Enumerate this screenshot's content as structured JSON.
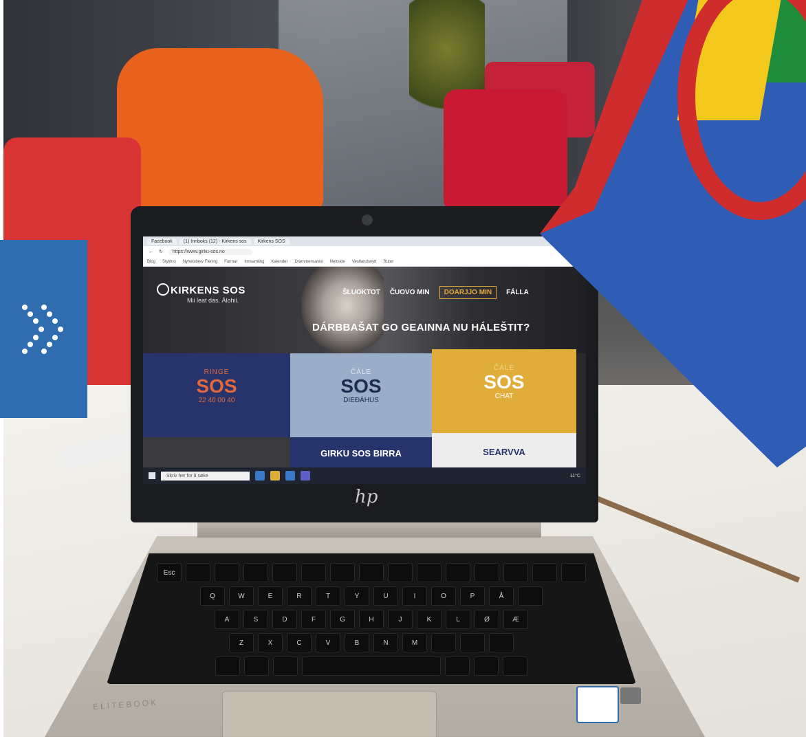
{
  "browser": {
    "tabs": [
      "Facebook",
      "(1) Innboks (12) - Kirkens sos",
      "Kirkens SOS"
    ],
    "url": "https://www.girku-sos.no",
    "bookmarks": [
      "Blog",
      "Stylitno",
      "Nyhetsbrev Flering",
      "Farmar",
      "Innsamling",
      "Kalender",
      "Drammensavisl",
      "Nettside",
      "Vestlandsnytt",
      "Ruter"
    ]
  },
  "site": {
    "logo": "KIRKENS SOS",
    "tagline": "Mii leat dás. Álohii.",
    "nav": [
      "ŠLUOKTOT",
      "ČUOVO MIN",
      "DOARJJO MIN",
      "FÁLLA"
    ],
    "hero_question": "DÁRBBAŠAT GO GEAINNA NU HÁLEŠTIT?",
    "tiles": [
      {
        "pre": "RINGE",
        "big": "SOS",
        "sub": "22 40 00 40"
      },
      {
        "pre": "ČÁLE",
        "big": "SOS",
        "sub": "DIEĐÁHUS"
      },
      {
        "pre": "ČÁLE",
        "big": "SOS",
        "sub": "CHAT"
      }
    ],
    "bottom_tiles": [
      "GIRKU SOS BIRRA",
      "SEARVVA"
    ]
  },
  "taskbar": {
    "search_placeholder": "Skriv her for å søke",
    "tray": "11°C"
  },
  "laptop": {
    "brand": "ELITEBOOK",
    "maker": "hp"
  },
  "colors": {
    "overlay_blue": "#2f6cb0",
    "flag_blue": "#2f5db5",
    "flag_red": "#cf2d2d",
    "flag_green": "#1f8c3c",
    "flag_yellow": "#f2c81c",
    "tile_navy": "#27346b",
    "tile_light_blue": "#9aadc9",
    "tile_gold": "#e0ad3a",
    "accent_orange": "#e5683c"
  },
  "overlay": {
    "icon": "double-chevron-right-icon"
  }
}
